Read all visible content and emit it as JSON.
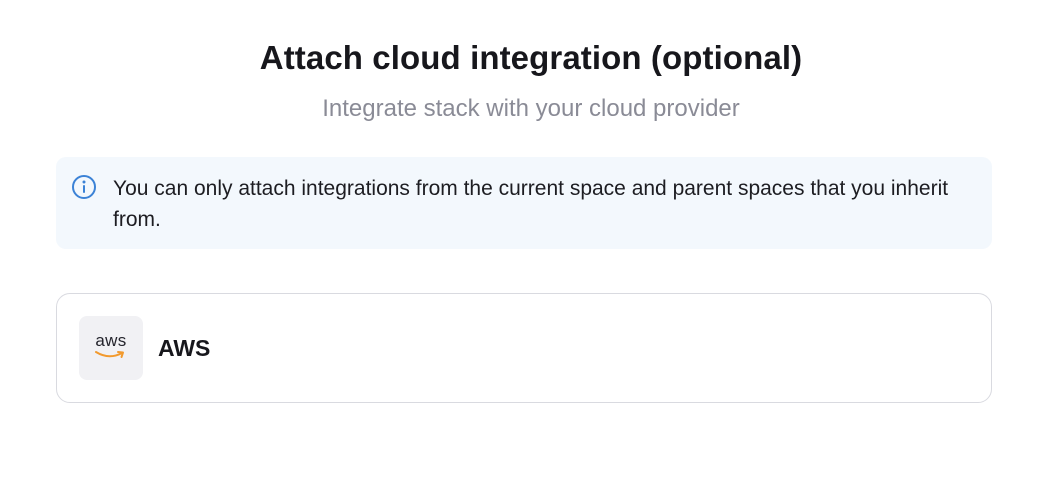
{
  "header": {
    "title": "Attach cloud integration (optional)",
    "subtitle": "Integrate stack with your cloud provider"
  },
  "notice": {
    "icon": "info-icon",
    "text": "You can only attach integrations from the current space and parent spaces that you inherit from.",
    "background_color": "#f3f8fd",
    "icon_color": "#3b82d6"
  },
  "integrations": [
    {
      "name": "AWS",
      "logo_text": "aws",
      "logo_icon": "aws-logo-icon",
      "logo_accent_color": "#f29a2e"
    }
  ]
}
